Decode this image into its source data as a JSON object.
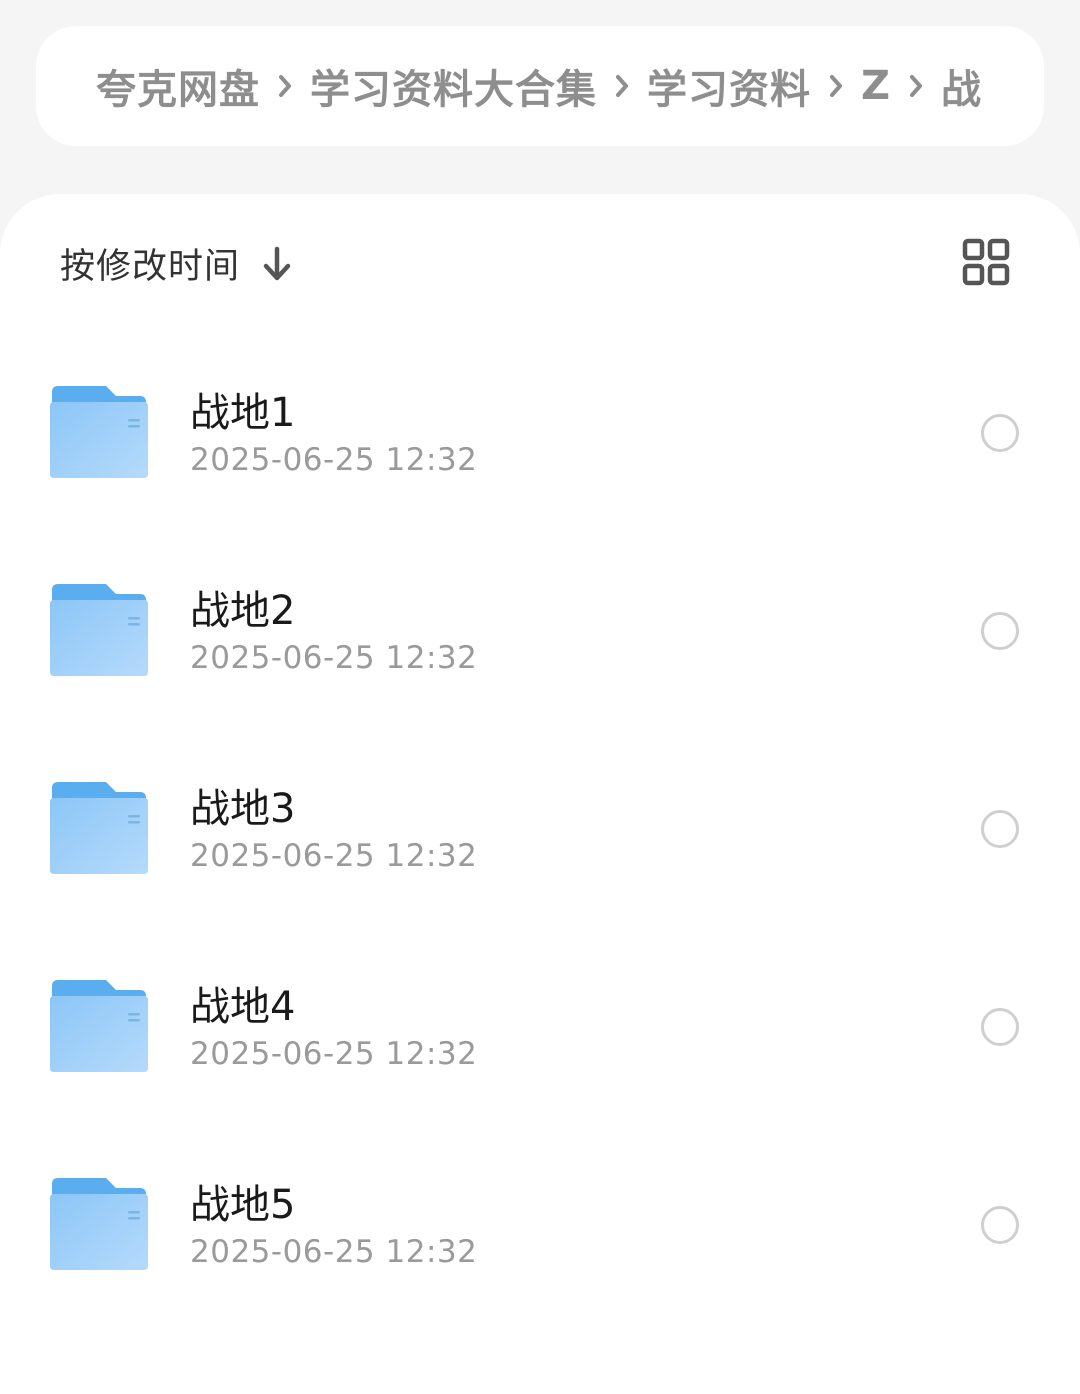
{
  "breadcrumb": {
    "items": [
      "夸克网盘",
      "学习资料大合集",
      "学习资料",
      "Z",
      "战地"
    ]
  },
  "toolbar": {
    "sort_label": "按修改时间",
    "sort_icon": "arrow-down-icon",
    "view_toggle_icon": "grid-view-icon"
  },
  "files": [
    {
      "name": "战地1",
      "date": "2025-06-25 12:32",
      "icon": "folder-icon"
    },
    {
      "name": "战地2",
      "date": "2025-06-25 12:32",
      "icon": "folder-icon"
    },
    {
      "name": "战地3",
      "date": "2025-06-25 12:32",
      "icon": "folder-icon"
    },
    {
      "name": "战地4",
      "date": "2025-06-25 12:32",
      "icon": "folder-icon"
    },
    {
      "name": "战地5",
      "date": "2025-06-25 12:32",
      "icon": "folder-icon"
    }
  ],
  "colors": {
    "folder_back": "#5aaef0",
    "folder_front_top": "#8cc6f7",
    "folder_front_bottom": "#b5dafb",
    "text_primary": "#1a1a1a",
    "text_secondary": "#9a9a9a",
    "breadcrumb_text": "#8e8e8e"
  }
}
